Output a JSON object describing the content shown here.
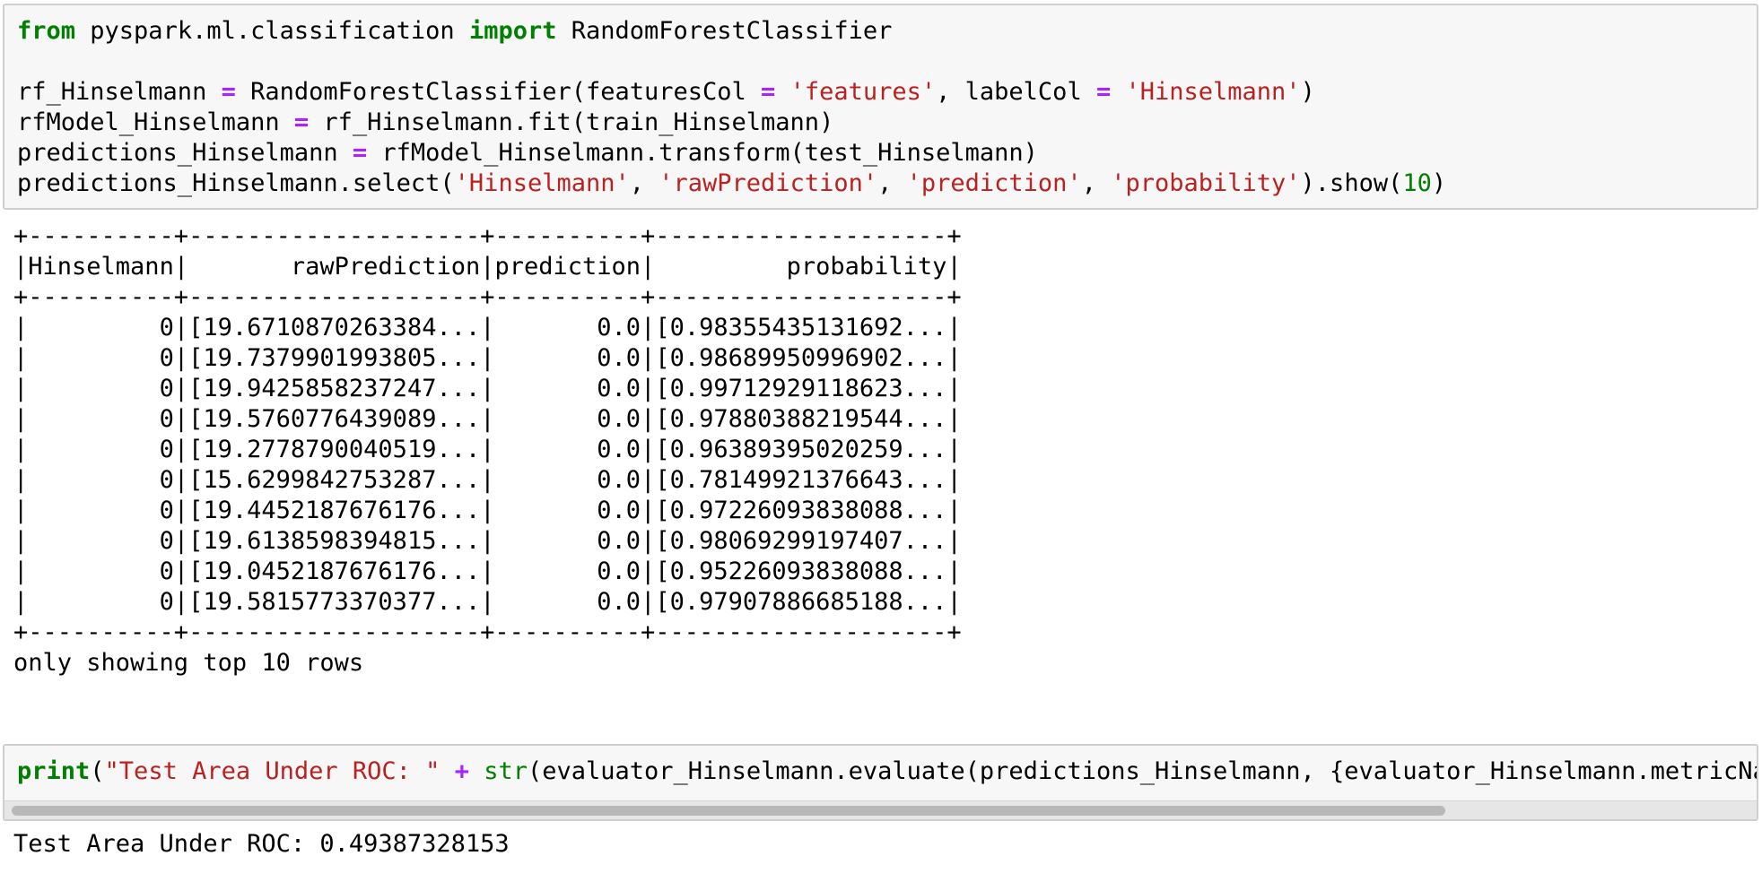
{
  "cell1": {
    "line1": {
      "kw_from": "from",
      "module": " pyspark.ml.classification ",
      "kw_import": "import",
      "name": " RandomForestClassifier"
    },
    "line3": {
      "var": "rf_Hinselmann ",
      "eq": "=",
      "call": " RandomForestClassifier(featuresCol ",
      "eq2": "=",
      "sp": " ",
      "s1": "'features'",
      "mid": ", labelCol ",
      "eq3": "=",
      "sp2": " ",
      "s2": "'Hinselmann'",
      "end": ")"
    },
    "line4": {
      "var": "rfModel_Hinselmann ",
      "eq": "=",
      "rest": " rf_Hinselmann.fit(train_Hinselmann)"
    },
    "line5": {
      "var": "predictions_Hinselmann ",
      "eq": "=",
      "rest": " rfModel_Hinselmann.transform(test_Hinselmann)"
    },
    "line6": {
      "pre": "predictions_Hinselmann.select(",
      "s1": "'Hinselmann'",
      "c1": ", ",
      "s2": "'rawPrediction'",
      "c2": ", ",
      "s3": "'prediction'",
      "c3": ", ",
      "s4": "'probability'",
      "mid": ").show(",
      "num": "10",
      "end": ")"
    }
  },
  "output1": {
    "border": "+----------+--------------------+----------+--------------------+",
    "headers": [
      "Hinselmann",
      "rawPrediction",
      "prediction",
      "probability"
    ],
    "rows": [
      [
        "0",
        "[19.6710870263384...",
        "0.0",
        "[0.98355435131692..."
      ],
      [
        "0",
        "[19.7379901993805...",
        "0.0",
        "[0.98689950996902..."
      ],
      [
        "0",
        "[19.9425858237247...",
        "0.0",
        "[0.99712929118623..."
      ],
      [
        "0",
        "[19.5760776439089...",
        "0.0",
        "[0.97880388219544..."
      ],
      [
        "0",
        "[19.2778790040519...",
        "0.0",
        "[0.96389395020259..."
      ],
      [
        "0",
        "[15.6299842753287...",
        "0.0",
        "[0.78149921376643..."
      ],
      [
        "0",
        "[19.4452187676176...",
        "0.0",
        "[0.97226093838088..."
      ],
      [
        "0",
        "[19.6138598394815...",
        "0.0",
        "[0.98069299197407..."
      ],
      [
        "0",
        "[19.0452187676176...",
        "0.0",
        "[0.95226093838088..."
      ],
      [
        "0",
        "[19.5815773370377...",
        "0.0",
        "[0.97907886685188..."
      ]
    ],
    "footer": "only showing top 10 rows"
  },
  "cell2": {
    "kw_print": "print",
    "open": "(",
    "s1": "\"Test Area Under ROC: \"",
    "sp": " ",
    "plus": "+",
    "sp2": " ",
    "bi_str": "str",
    "rest": "(evaluator_Hinselmann.evaluate(predictions_Hinselmann, {evaluator_Hinselmann.metricName"
  },
  "output2": {
    "text": "Test Area Under ROC: 0.49387328153"
  }
}
